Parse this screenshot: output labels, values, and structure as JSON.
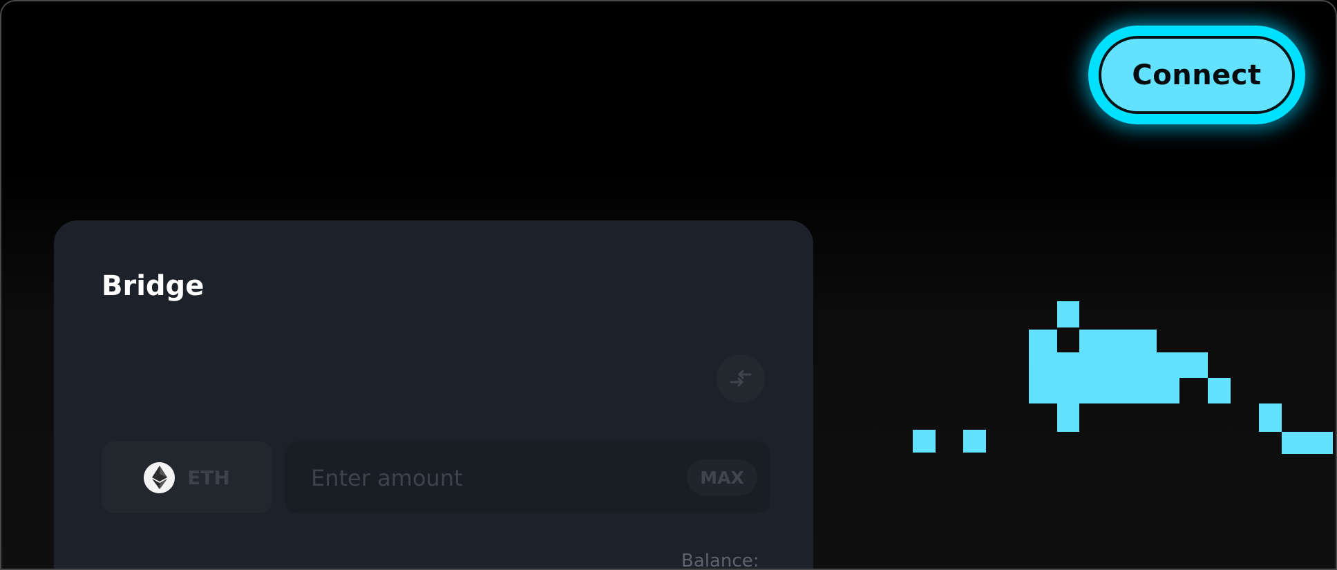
{
  "header": {
    "connect_label": "Connect"
  },
  "bridge": {
    "title": "Bridge",
    "token": {
      "symbol": "ETH",
      "icon": "ethereum-icon"
    },
    "amount": {
      "placeholder": "Enter amount",
      "value": ""
    },
    "max_label": "MAX",
    "balance_label": "Balance:",
    "swap_icon": "swap-arrows-icon"
  },
  "colors": {
    "accent": "#62e2ff",
    "accent_glow": "#00e1ff",
    "card_bg": "#1d222a",
    "page_bg": "#000000"
  }
}
